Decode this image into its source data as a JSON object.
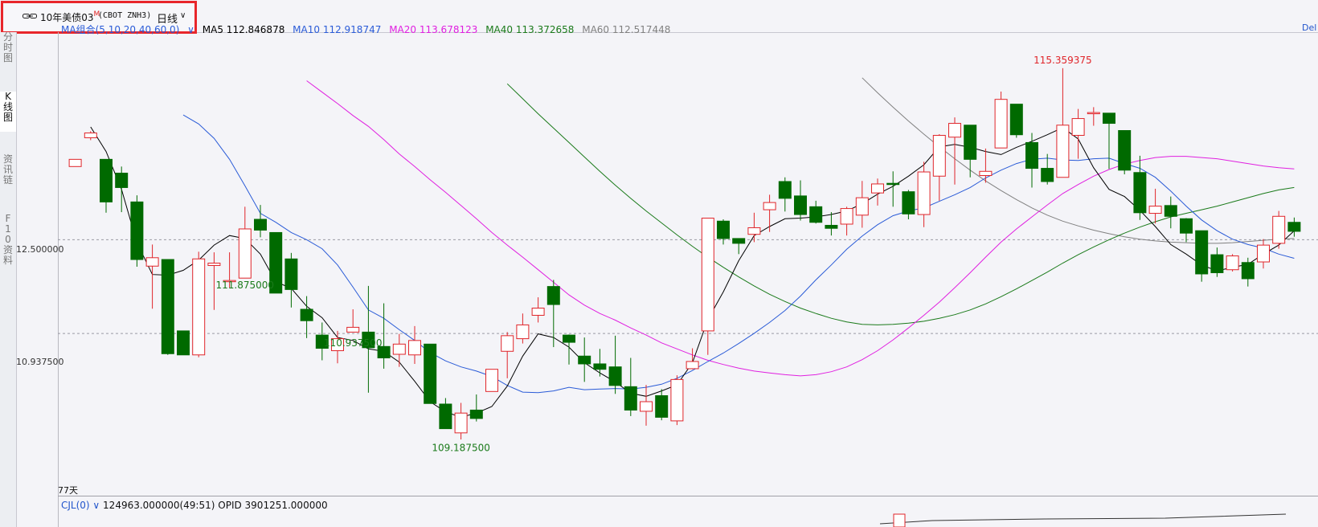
{
  "toolbar": {
    "symbol": "10年美债03",
    "flag": "M",
    "code": "(CBOT ZNH3)",
    "period": "日线"
  },
  "sidebar_tabs": [
    {
      "label": "分时图",
      "active": false
    },
    {
      "label": "K线图",
      "active": true
    },
    {
      "label": "资讯链",
      "active": false
    },
    {
      "label": "F10资料",
      "active": false
    }
  ],
  "ma_legend": {
    "combo_label": "MA组合(5,10,20,40,60,0)",
    "items": [
      {
        "label": "MA5 112.846878",
        "color": "#000000"
      },
      {
        "label": "MA10 112.918747",
        "color": "#2a5bd7"
      },
      {
        "label": "MA20 113.678123",
        "color": "#e020e0"
      },
      {
        "label": "MA40 113.372658",
        "color": "#1a7a1a"
      },
      {
        "label": "MA60 112.517448",
        "color": "#808080"
      }
    ],
    "right_label": "Del"
  },
  "y_axis": {
    "labels": [
      "12.500000",
      "10.937500"
    ]
  },
  "annotations": {
    "high": "115.359375",
    "low_mid": "110.937500",
    "low_bottom": "109.187500",
    "low_right": "111.875000"
  },
  "days_label": "77天",
  "volume": {
    "name": "CJL(0)",
    "value": "124963.000000(49:51)",
    "opid": "OPID 3901251.000000"
  },
  "chart_data": {
    "type": "candlestick",
    "instrument": "10年美债03 (CBOT ZNH3)",
    "period": "日线",
    "candles": [
      {
        "o": 113.72,
        "c": 113.84,
        "h": 113.84,
        "l": 113.72,
        "up": true
      },
      {
        "o": 114.2,
        "c": 114.28,
        "h": 114.31,
        "l": 114.16,
        "up": true
      },
      {
        "o": 113.84,
        "c": 113.13,
        "h": 113.84,
        "l": 112.95,
        "up": false
      },
      {
        "o": 113.61,
        "c": 113.37,
        "h": 113.72,
        "l": 112.96,
        "up": false
      },
      {
        "o": 113.13,
        "c": 112.17,
        "h": 113.24,
        "l": 112.05,
        "up": false
      },
      {
        "o": 112.06,
        "c": 112.2,
        "h": 112.42,
        "l": 111.35,
        "up": true
      },
      {
        "o": 112.17,
        "c": 110.6,
        "h": 112.17,
        "l": 110.58,
        "up": false
      },
      {
        "o": 110.98,
        "c": 110.58,
        "h": 110.98,
        "l": 110.58,
        "up": false
      },
      {
        "o": 110.58,
        "c": 112.18,
        "h": 112.3,
        "l": 110.54,
        "up": true
      },
      {
        "o": 112.07,
        "c": 112.11,
        "h": 112.29,
        "l": 111.33,
        "up": true
      },
      {
        "o": 111.82,
        "c": 111.82,
        "h": 112.29,
        "l": 111.7,
        "up": true
      },
      {
        "o": 111.86,
        "c": 112.68,
        "h": 113.05,
        "l": 111.86,
        "up": true
      },
      {
        "o": 112.84,
        "c": 112.66,
        "h": 113.08,
        "l": 112.54,
        "up": false
      },
      {
        "o": 112.62,
        "c": 111.61,
        "h": 112.62,
        "l": 111.61,
        "up": false
      },
      {
        "o": 112.18,
        "c": 111.67,
        "h": 112.28,
        "l": 111.37,
        "up": false
      },
      {
        "o": 111.34,
        "c": 111.15,
        "h": 111.56,
        "l": 110.86,
        "up": false
      },
      {
        "o": 110.91,
        "c": 110.69,
        "h": 111.12,
        "l": 110.49,
        "up": false
      },
      {
        "o": 110.85,
        "c": 110.65,
        "h": 110.98,
        "l": 110.44,
        "up": true
      },
      {
        "o": 111.04,
        "c": 110.96,
        "h": 111.34,
        "l": 110.96,
        "up": true
      },
      {
        "o": 110.96,
        "c": 110.7,
        "h": 111.73,
        "l": 109.95,
        "up": false
      },
      {
        "o": 110.72,
        "c": 110.53,
        "h": 111.44,
        "l": 110.35,
        "up": false
      },
      {
        "o": 110.76,
        "c": 110.59,
        "h": 110.93,
        "l": 110.38,
        "up": true
      },
      {
        "o": 110.58,
        "c": 110.82,
        "h": 111.06,
        "l": 110.43,
        "up": true
      },
      {
        "o": 110.76,
        "c": 109.77,
        "h": 110.76,
        "l": 109.77,
        "up": false
      },
      {
        "o": 109.76,
        "c": 109.35,
        "h": 109.86,
        "l": 109.35,
        "up": false
      },
      {
        "o": 109.61,
        "c": 109.28,
        "h": 109.78,
        "l": 109.17,
        "up": true
      },
      {
        "o": 109.66,
        "c": 109.52,
        "h": 109.92,
        "l": 109.47,
        "up": false
      },
      {
        "o": 109.97,
        "c": 110.34,
        "h": 110.34,
        "l": 109.97,
        "up": true
      },
      {
        "o": 110.64,
        "c": 110.9,
        "h": 110.96,
        "l": 110.19,
        "up": true
      },
      {
        "o": 111.08,
        "c": 110.85,
        "h": 111.27,
        "l": 110.77,
        "up": true
      },
      {
        "o": 111.24,
        "c": 111.36,
        "h": 111.54,
        "l": 111.12,
        "up": true
      },
      {
        "o": 111.42,
        "c": 111.72,
        "h": 111.83,
        "l": 110.71,
        "up": false
      },
      {
        "o": 110.91,
        "c": 110.79,
        "h": 110.92,
        "l": 110.42,
        "up": false
      },
      {
        "o": 110.56,
        "c": 110.43,
        "h": 110.87,
        "l": 110.13,
        "up": false
      },
      {
        "o": 110.43,
        "c": 110.34,
        "h": 110.68,
        "l": 110.22,
        "up": false
      },
      {
        "o": 110.38,
        "c": 110.07,
        "h": 110.9,
        "l": 109.93,
        "up": false
      },
      {
        "o": 110.05,
        "c": 109.66,
        "h": 110.53,
        "l": 109.56,
        "up": false
      },
      {
        "o": 109.8,
        "c": 109.64,
        "h": 110.08,
        "l": 109.4,
        "up": true
      },
      {
        "o": 109.9,
        "c": 109.54,
        "h": 110.01,
        "l": 109.49,
        "up": false
      },
      {
        "o": 110.17,
        "c": 109.48,
        "h": 110.24,
        "l": 109.41,
        "up": true
      },
      {
        "o": 110.35,
        "c": 110.47,
        "h": 110.69,
        "l": 110.34,
        "up": true
      },
      {
        "o": 110.98,
        "c": 112.86,
        "h": 112.86,
        "l": 110.58,
        "up": true
      },
      {
        "o": 112.81,
        "c": 112.52,
        "h": 112.84,
        "l": 112.42,
        "up": false
      },
      {
        "o": 112.52,
        "c": 112.44,
        "h": 112.52,
        "l": 112.26,
        "up": false
      },
      {
        "o": 112.59,
        "c": 112.7,
        "h": 112.95,
        "l": 112.46,
        "up": true
      },
      {
        "o": 113.0,
        "c": 113.12,
        "h": 113.25,
        "l": 112.63,
        "up": true
      },
      {
        "o": 113.47,
        "c": 113.19,
        "h": 113.54,
        "l": 112.97,
        "up": false
      },
      {
        "o": 113.23,
        "c": 112.92,
        "h": 113.49,
        "l": 112.82,
        "up": false
      },
      {
        "o": 113.05,
        "c": 112.79,
        "h": 113.15,
        "l": 112.77,
        "up": false
      },
      {
        "o": 112.74,
        "c": 112.69,
        "h": 112.96,
        "l": 112.57,
        "up": false
      },
      {
        "o": 112.76,
        "c": 113.02,
        "h": 113.05,
        "l": 112.57,
        "up": true
      },
      {
        "o": 112.91,
        "c": 113.2,
        "h": 113.48,
        "l": 112.7,
        "up": true
      },
      {
        "o": 113.28,
        "c": 113.43,
        "h": 113.52,
        "l": 113.07,
        "up": true
      },
      {
        "o": 113.44,
        "c": 113.44,
        "h": 113.64,
        "l": 113.05,
        "up": false
      },
      {
        "o": 113.3,
        "c": 112.93,
        "h": 113.33,
        "l": 112.84,
        "up": false
      },
      {
        "o": 112.92,
        "c": 113.63,
        "h": 113.8,
        "l": 112.71,
        "up": true
      },
      {
        "o": 113.56,
        "c": 114.24,
        "h": 114.26,
        "l": 113.15,
        "up": true
      },
      {
        "o": 114.21,
        "c": 114.44,
        "h": 114.54,
        "l": 113.42,
        "up": true
      },
      {
        "o": 114.41,
        "c": 113.84,
        "h": 114.41,
        "l": 113.54,
        "up": false
      },
      {
        "o": 113.57,
        "c": 113.64,
        "h": 114.02,
        "l": 113.45,
        "up": true
      },
      {
        "o": 114.03,
        "c": 114.84,
        "h": 114.97,
        "l": 114.03,
        "up": true
      },
      {
        "o": 114.76,
        "c": 114.25,
        "h": 114.76,
        "l": 114.2,
        "up": false
      },
      {
        "o": 114.12,
        "c": 113.69,
        "h": 114.28,
        "l": 113.37,
        "up": false
      },
      {
        "o": 113.69,
        "c": 113.47,
        "h": 113.93,
        "l": 113.42,
        "up": false
      },
      {
        "o": 113.54,
        "c": 114.41,
        "h": 115.36,
        "l": 113.55,
        "up": true
      },
      {
        "o": 114.24,
        "c": 114.52,
        "h": 114.68,
        "l": 113.85,
        "up": true
      },
      {
        "o": 114.61,
        "c": 114.62,
        "h": 114.71,
        "l": 114.4,
        "up": true
      },
      {
        "o": 114.61,
        "c": 114.44,
        "h": 114.61,
        "l": 113.68,
        "up": false
      },
      {
        "o": 114.32,
        "c": 113.66,
        "h": 114.32,
        "l": 113.59,
        "up": false
      },
      {
        "o": 113.62,
        "c": 112.95,
        "h": 113.9,
        "l": 112.83,
        "up": false
      },
      {
        "o": 113.06,
        "c": 112.94,
        "h": 113.35,
        "l": 112.77,
        "up": true
      },
      {
        "o": 113.07,
        "c": 112.89,
        "h": 113.22,
        "l": 112.69,
        "up": false
      },
      {
        "o": 112.85,
        "c": 112.61,
        "h": 112.86,
        "l": 112.46,
        "up": false
      },
      {
        "o": 112.65,
        "c": 111.93,
        "h": 112.65,
        "l": 111.8,
        "up": false
      },
      {
        "o": 112.25,
        "c": 111.95,
        "h": 112.37,
        "l": 111.88,
        "up": false
      },
      {
        "o": 112.23,
        "c": 112.0,
        "h": 112.26,
        "l": 111.97,
        "up": true
      },
      {
        "o": 112.12,
        "c": 111.85,
        "h": 112.2,
        "l": 111.72,
        "up": false
      },
      {
        "o": 112.13,
        "c": 112.41,
        "h": 112.51,
        "l": 112.02,
        "up": true
      },
      {
        "o": 112.44,
        "c": 112.89,
        "h": 112.98,
        "l": 112.35,
        "up": true
      },
      {
        "o": 112.79,
        "c": 112.64,
        "h": 112.87,
        "l": 112.55,
        "up": false
      }
    ],
    "ma_lines": {
      "MA5": [
        114.38,
        113.97,
        113.34,
        112.45,
        111.92,
        111.91,
        111.99,
        112.16,
        112.41,
        112.57,
        112.52,
        112.26,
        111.8,
        111.69,
        111.39,
        111.2,
        110.87,
        110.82,
        110.68,
        110.64,
        110.46,
        110.14,
        109.8,
        109.63,
        109.54,
        109.61,
        109.72,
        110.06,
        110.56,
        110.93,
        110.87,
        110.71,
        110.45,
        110.28,
        110.13,
        109.94,
        109.89,
        109.98,
        110.08,
        110.45,
        111.17,
        111.63,
        112.15,
        112.57,
        112.72,
        112.85,
        112.86,
        112.88,
        112.92,
        112.98,
        113.1,
        113.26,
        113.39,
        113.56,
        113.75,
        114.05,
        114.09,
        114.04,
        113.97,
        113.92,
        114.04,
        114.14,
        114.25,
        114.37,
        114.18,
        113.7,
        113.34,
        113.22,
        112.99,
        112.72,
        112.42,
        112.26,
        112.08,
        111.98,
        112.04,
        112.09,
        112.26,
        112.41,
        112.65
      ],
      "MA10": [
        114.58,
        114.43,
        114.19,
        113.84,
        113.4,
        112.94,
        112.79,
        112.62,
        112.5,
        112.35,
        112.08,
        111.71,
        111.33,
        111.19,
        111.0,
        110.82,
        110.62,
        110.48,
        110.38,
        110.31,
        110.22,
        110.07,
        109.96,
        109.95,
        109.98,
        110.04,
        110.0,
        110.01,
        110.02,
        110.01,
        110.04,
        110.09,
        110.19,
        110.32,
        110.47,
        110.61,
        110.77,
        110.94,
        111.12,
        111.32,
        111.56,
        111.83,
        112.08,
        112.34,
        112.56,
        112.75,
        112.9,
        112.98,
        113.03,
        113.14,
        113.25,
        113.37,
        113.53,
        113.66,
        113.77,
        113.84,
        113.86,
        113.83,
        113.82,
        113.85,
        113.86,
        113.77,
        113.69,
        113.54,
        113.31,
        113.06,
        112.83,
        112.65,
        112.51,
        112.42,
        112.36,
        112.26,
        112.19
      ],
      "MA20": [
        115.15,
        114.96,
        114.77,
        114.57,
        114.39,
        114.17,
        113.93,
        113.72,
        113.5,
        113.29,
        113.07,
        112.85,
        112.62,
        112.41,
        112.21,
        112.0,
        111.79,
        111.58,
        111.41,
        111.27,
        111.16,
        111.03,
        110.91,
        110.78,
        110.68,
        110.58,
        110.49,
        110.42,
        110.36,
        110.31,
        110.28,
        110.25,
        110.23,
        110.25,
        110.3,
        110.38,
        110.5,
        110.65,
        110.83,
        111.03,
        111.24,
        111.46,
        111.7,
        111.95,
        112.21,
        112.46,
        112.68,
        112.88,
        113.08,
        113.27,
        113.42,
        113.56,
        113.67,
        113.76,
        113.82,
        113.87,
        113.89,
        113.89,
        113.87,
        113.85,
        113.81,
        113.77,
        113.73,
        113.7,
        113.68
      ],
      "MA40": [
        115.1,
        114.85,
        114.6,
        114.36,
        114.12,
        113.88,
        113.64,
        113.41,
        113.19,
        112.98,
        112.78,
        112.58,
        112.39,
        112.21,
        112.04,
        111.88,
        111.73,
        111.59,
        111.47,
        111.36,
        111.27,
        111.19,
        111.13,
        111.09,
        111.08,
        111.09,
        111.11,
        111.14,
        111.19,
        111.25,
        111.33,
        111.43,
        111.55,
        111.68,
        111.82,
        111.96,
        112.11,
        112.25,
        112.38,
        112.5,
        112.61,
        112.71,
        112.8,
        112.88,
        112.94,
        113.0,
        113.06,
        113.13,
        113.2,
        113.27,
        113.33,
        113.37
      ],
      "MA60": [
        115.2,
        114.95,
        114.71,
        114.48,
        114.26,
        114.05,
        113.85,
        113.66,
        113.48,
        113.32,
        113.17,
        113.03,
        112.91,
        112.81,
        112.73,
        112.66,
        112.6,
        112.55,
        112.51,
        112.48,
        112.46,
        112.45,
        112.44,
        112.44,
        112.45,
        112.47,
        112.49,
        112.51,
        112.52
      ]
    },
    "ma_colors": {
      "MA5": "#000000",
      "MA10": "#2a5bd7",
      "MA20": "#e020e0",
      "MA40": "#1a7a1a",
      "MA60": "#808080"
    },
    "up_color": "#e0252a",
    "down_color": "#006a00",
    "ylim": [
      108.3,
      115.8
    ],
    "reference_levels": [
      112.5,
      110.9375
    ],
    "marked_values": {
      "high": 115.359375,
      "low_mid": 110.9375,
      "low_bottom": 109.1875,
      "low_right": 111.875
    }
  }
}
